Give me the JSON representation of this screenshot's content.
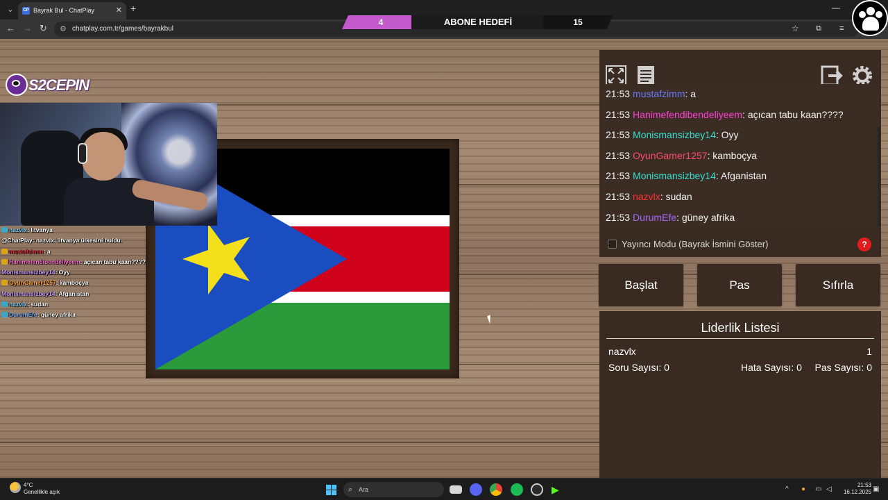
{
  "browser": {
    "tab_title": "Bayrak Bul - ChatPlay",
    "tab_favicon": "CP",
    "url": "chatplay.com.tr/games/bayrakbul"
  },
  "goal_banner": {
    "current": "4",
    "label": "ABONE HEDEFİ",
    "target": "15"
  },
  "overlay": {
    "brand": "S2CEPIN",
    "stream_chat": [
      {
        "user": "nazvlx",
        "text": ": litvanya",
        "color": "#7fd6ff",
        "badge": "b"
      },
      {
        "user": "@ChatPlay",
        "text": ": nazvlx, litvanya ülkesini buldu.",
        "color": "#ffffff",
        "badge": ""
      },
      {
        "user": "mustafzimm",
        "text": ": a",
        "color": "#e0303b",
        "badge": "y"
      },
      {
        "user": "Hanimefendibendeliyeem",
        "text": ": açıcan tabu kaan????",
        "color": "#ff6fd0",
        "badge": "y"
      },
      {
        "user": "Monismansizbey14",
        "text": ": Oyy",
        "color": "#c79bff",
        "badge": ""
      },
      {
        "user": "OyunGamer1257",
        "text": ": kamboçya",
        "color": "#ffa23d",
        "badge": "y"
      },
      {
        "user": "Monismansizbey14",
        "text": ": Afganistan",
        "color": "#c79bff",
        "badge": ""
      },
      {
        "user": "nazvlx",
        "text": ": sudan",
        "color": "#7fd6ff",
        "badge": "b"
      },
      {
        "user": "DurumEfe",
        "text": ": güney afrika",
        "color": "#8ab8ff",
        "badge": "b"
      }
    ]
  },
  "chat": {
    "messages": [
      {
        "time": "21:53",
        "user": "mustafzimm",
        "user_color": "#6b7cff",
        "text": ": a"
      },
      {
        "time": "21:53",
        "user": "Hanimefendibendeliyeem",
        "user_color": "#ff3fd6",
        "text": ": açıcan tabu kaan????"
      },
      {
        "time": "21:53",
        "user": "Monismansizbey14",
        "user_color": "#33e0d0",
        "text": ": Oyy"
      },
      {
        "time": "21:53",
        "user": "OyunGamer1257",
        "user_color": "#ff4a6a",
        "text": ": kamboçya"
      },
      {
        "time": "21:53",
        "user": "Monismansizbey14",
        "user_color": "#33e0d0",
        "text": ": Afganistan"
      },
      {
        "time": "21:53",
        "user": "nazvlx",
        "user_color": "#ff3030",
        "text": ": sudan"
      },
      {
        "time": "21:53",
        "user": "DurumEfe",
        "user_color": "#a566ff",
        "text": ": güney afrika"
      }
    ],
    "streamer_mode_label": "Yayıncı Modu (Bayrak İsmini Göster)",
    "streamer_mode_checked": false,
    "help_label": "?"
  },
  "controls": {
    "start": "Başlat",
    "pass": "Pas",
    "reset": "Sıfırla"
  },
  "leaderboard": {
    "title": "Liderlik Listesi",
    "entries": [
      {
        "name": "nazvlx",
        "score": "1"
      }
    ],
    "question_count": "Soru Sayısı: 0",
    "error_count": "Hata Sayısı: 0",
    "pass_count": "Pas Sayısı: 0"
  },
  "taskbar": {
    "temperature": "4°C",
    "weather": "Genellikle açık",
    "search_placeholder": "Ara",
    "time": "21:53",
    "date": "16.12.2025"
  },
  "colors": {
    "wood": "#9a806a",
    "panel": "#3a2b22",
    "flag_black": "#000000",
    "flag_red": "#d0021b",
    "flag_green": "#2b9a3b",
    "flag_blue": "#1a4ec0",
    "flag_star": "#f4e01a"
  }
}
